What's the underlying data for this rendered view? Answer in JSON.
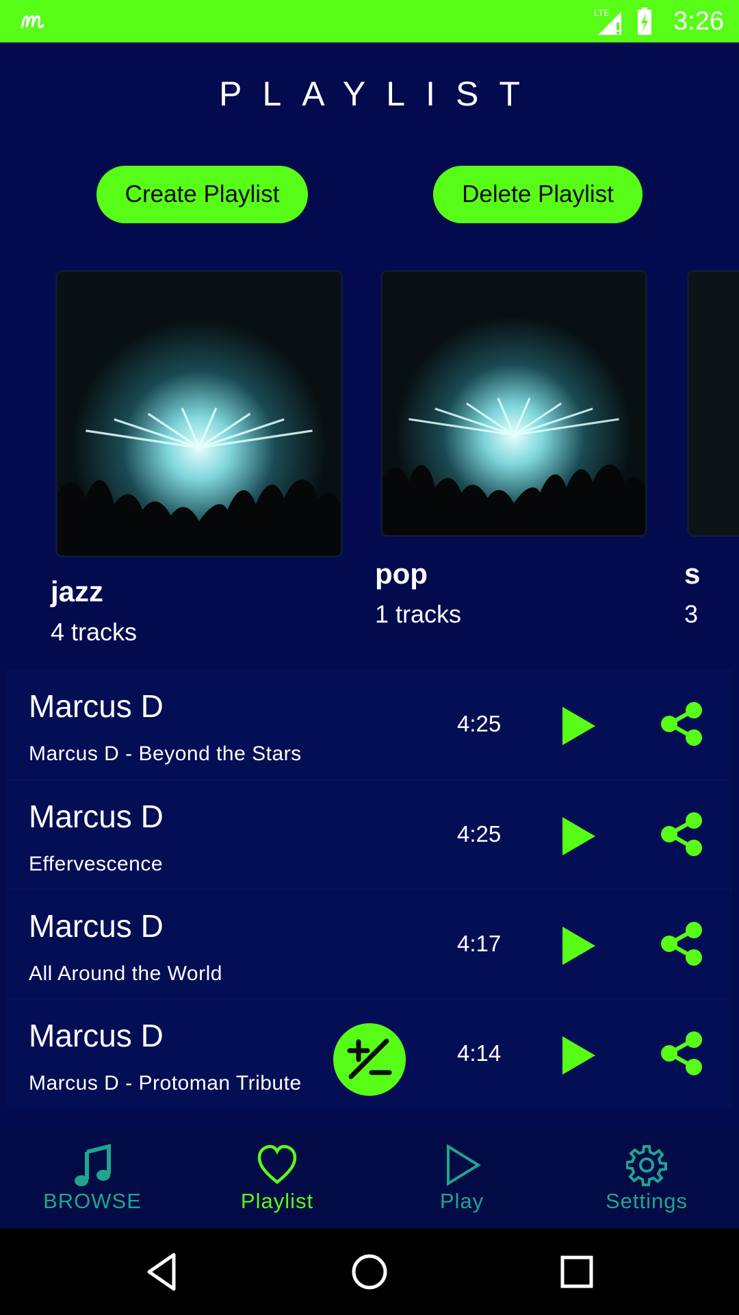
{
  "status_bar": {
    "time": "3:26",
    "network": "LTE",
    "background_color": "#57fd17"
  },
  "header": {
    "title": "PLAYLIST"
  },
  "actions": {
    "create_label": "Create Playlist",
    "delete_label": "Delete Playlist"
  },
  "playlists": [
    {
      "name": "jazz",
      "tracks": "4 tracks"
    },
    {
      "name": "pop",
      "tracks": "1 tracks"
    },
    {
      "name": "s",
      "tracks": "3"
    }
  ],
  "tracks": [
    {
      "artist": "Marcus D",
      "title": "Marcus D - Beyond the Stars",
      "duration": "4:25"
    },
    {
      "artist": "Marcus D",
      "title": "Effervescence",
      "duration": "4:25"
    },
    {
      "artist": "Marcus D",
      "title": "All Around the World",
      "duration": "4:17"
    },
    {
      "artist": "Marcus D",
      "title": "Marcus D - Protoman Tribute",
      "duration": "4:14"
    }
  ],
  "bottom_nav": {
    "items": [
      {
        "label": "BROWSE",
        "icon": "music-note-icon",
        "active": false
      },
      {
        "label": "Playlist",
        "icon": "heart-icon",
        "active": true
      },
      {
        "label": "Play",
        "icon": "play-outline-icon",
        "active": false
      },
      {
        "label": "Settings",
        "icon": "gear-icon",
        "active": false
      }
    ]
  },
  "colors": {
    "accent": "#57fd17",
    "background": "#030a4e",
    "nav_inactive": "#1fa58e",
    "nav_active": "#57fd17"
  }
}
